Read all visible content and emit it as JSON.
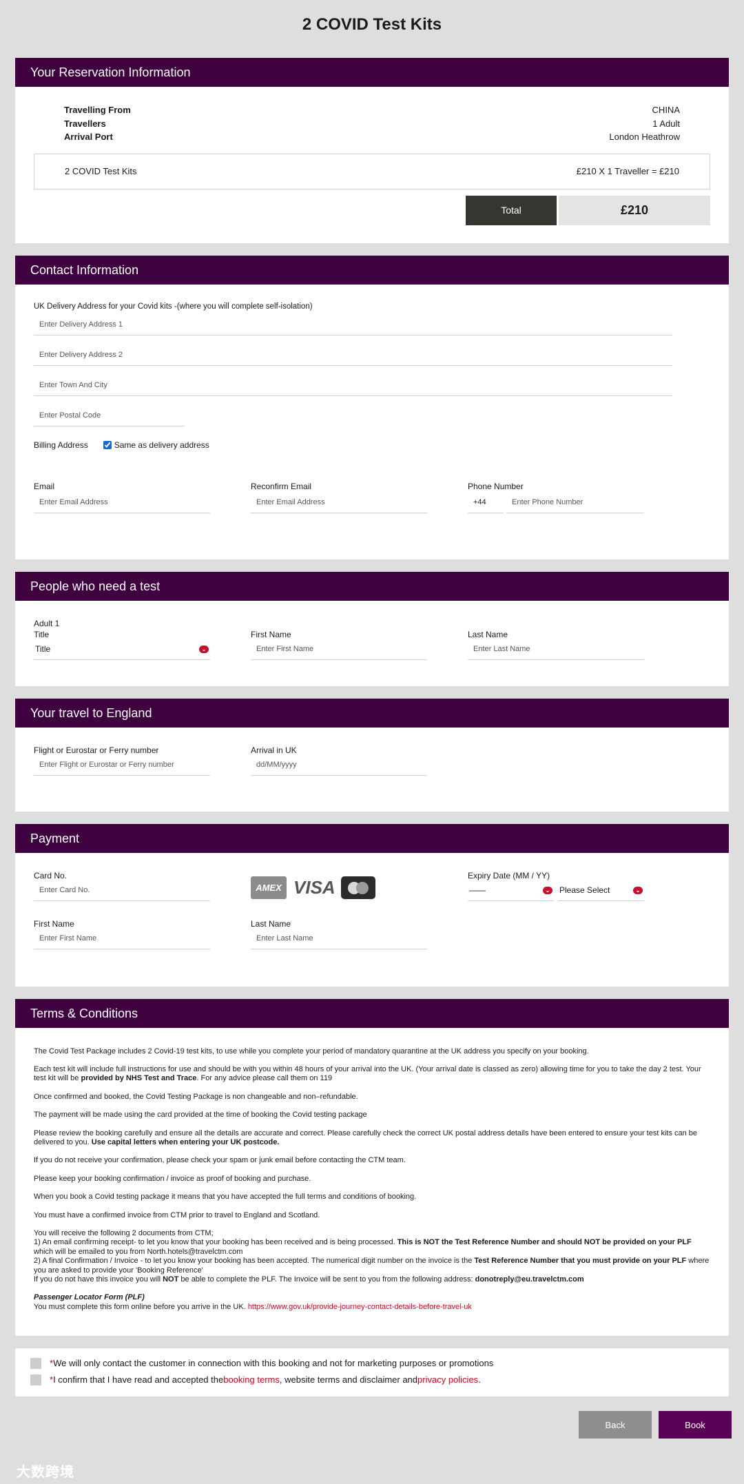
{
  "page": {
    "title": "2 COVID Test Kits"
  },
  "reservation": {
    "header": "Your Reservation Information",
    "rows": [
      {
        "label": "Travelling From",
        "value": "CHINA"
      },
      {
        "label": "Travellers",
        "value": "1 Adult"
      },
      {
        "label": "Arrival Port",
        "value": "London Heathrow"
      }
    ],
    "item_name": "2 COVID Test Kits",
    "item_price": "£210 X 1 Traveller = £210",
    "total_label": "Total",
    "total_value": "£210"
  },
  "contact": {
    "header": "Contact Information",
    "delivery_note": "UK Delivery Address for your Covid kits -(where you will complete self-isolation)",
    "address1_placeholder": "Enter Delivery Address 1",
    "address2_placeholder": "Enter Delivery Address 2",
    "town_placeholder": "Enter Town And City",
    "postcode_placeholder": "Enter Postal Code",
    "billing_label": "Billing Address",
    "same_as_delivery": "Same as delivery address",
    "email_label": "Email",
    "email_placeholder": "Enter Email Address",
    "reconfirm_label": "Reconfirm Email",
    "reconfirm_placeholder": "Enter Email Address",
    "phone_label": "Phone Number",
    "phone_code": "+44",
    "phone_placeholder": "Enter Phone Number"
  },
  "people": {
    "header": "People who need a test",
    "adult_label": "Adult 1",
    "title_label": "Title",
    "title_value": "Title",
    "first_label": "First Name",
    "first_placeholder": "Enter First Name",
    "last_label": "Last Name",
    "last_placeholder": "Enter Last Name"
  },
  "travel": {
    "header": "Your travel to England",
    "flight_label": "Flight or Eurostar or Ferry number",
    "flight_placeholder": "Enter Flight or Eurostar or Ferry number",
    "arrival_label": "Arrival in UK",
    "arrival_placeholder": "dd/MM/yyyy"
  },
  "payment": {
    "header": "Payment",
    "card_label": "Card No.",
    "card_placeholder": "Enter Card No.",
    "amex": "AMEX",
    "visa": "VISA",
    "mastercard": "MasterCard",
    "expiry_label": "Expiry Date (MM / YY)",
    "expiry_month": "——",
    "expiry_year": "Please Select",
    "first_label": "First Name",
    "first_placeholder": "Enter First Name",
    "last_label": "Last Name",
    "last_placeholder": "Enter Last Name"
  },
  "terms": {
    "header": "Terms & Conditions",
    "p1": "The Covid Test Package includes 2 Covid-19 test kits, to use while you complete your period of mandatory quarantine at the UK address you specify on your booking.",
    "p2a": "Each test kit will include full instructions for use and should be with you within 48 hours of your arrival into the UK. (Your arrival date is classed as zero) allowing time for you to take the day 2 test. Your test kit will be ",
    "p2b": "provided by NHS Test and Trace",
    "p2c": ". For any advice please call them on 119",
    "p3": "Once confirmed and booked, the Covid Testing Package is non changeable and non–refundable.",
    "p4": "The payment will be made using the card provided at the time of booking the Covid testing package",
    "p5a": "Please review the booking carefully and ensure all the details are accurate and correct. Please carefully check the correct UK postal address details have been entered to ensure your test kits can be delivered to you. ",
    "p5b": "Use capital letters when entering your UK postcode.",
    "p6": "If you do not receive your confirmation, please check your spam or junk email before contacting the CTM team.",
    "p7": "Please keep your booking confirmation / invoice as proof of booking and purchase.",
    "p8": "When you book a Covid testing package it means that you have accepted the full terms and conditions of booking.",
    "p9": "You must have a confirmed invoice from CTM prior to travel to England and Scotland.",
    "p10a": "You will receive the following 2 documents from CTM;",
    "p10b": "1) An email confirming receipt- to let you know that your booking has been received and is being processed. ",
    "p10c": "This is NOT the Test Reference Number and should NOT be provided on your PLF",
    "p10d": " which will be emailed to you from North.hotels@travelctm.com",
    "p10e": "2) A final Confirmation / Invoice - to let you know your booking has been accepted. The numerical digit number on the invoice is the ",
    "p10f": "Test Reference Number that you must provide on your PLF",
    "p10g": " where you are asked to provide your 'Booking Reference'",
    "p10h": "If you do not have this invoice you will ",
    "p10i": "NOT",
    "p10j": " be able to complete the PLF. The Invoice will be sent to you from the following address: ",
    "p10k": "donotreply@eu.travelctm.com",
    "plf_title": "Passenger Locator Form (PLF)",
    "plf_text": "You must complete this form online before you arrive in the UK. ",
    "plf_link": "https://www.gov.uk/provide-journey-contact-details-before-travel-uk"
  },
  "consent": {
    "c1_star": "*",
    "c1_text": "We will only contact the customer in connection with this booking and not for marketing purposes or promotions",
    "c2_star": "*",
    "c2_a": "I confirm that I have read and accepted the ",
    "c2_link1": "booking terms",
    "c2_b": ", website terms and disclaimer and ",
    "c2_link2": "privacy policies",
    "c2_c": "."
  },
  "buttons": {
    "back": "Back",
    "book": "Book"
  },
  "watermark": "大数跨境",
  "colors": {
    "header": "#3f0040",
    "accent_red": "#d2001f",
    "book": "#5b0057",
    "back": "#8e8e8e"
  }
}
